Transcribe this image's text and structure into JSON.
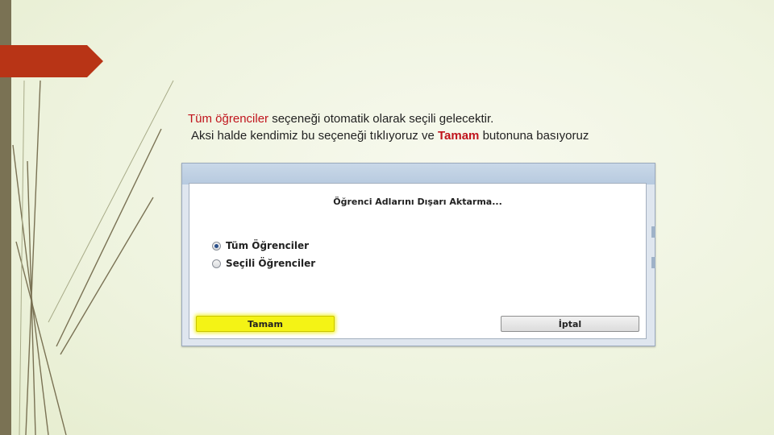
{
  "caption": {
    "line1_highlight": "Tüm öğrenciler",
    "line1_rest": " seçeneği otomatik olarak seçili gelecektir.",
    "line2_start": "Aksi halde kendimiz bu seçeneği tıklıyoruz ve ",
    "line2_highlight": "Tamam",
    "line2_end": " butonuna basıyoruz"
  },
  "dialog": {
    "title": "Öğrenci Adlarını Dışarı Aktarma...",
    "options": [
      {
        "label": "Tüm Öğrenciler",
        "checked": true
      },
      {
        "label": "Seçili Öğrenciler",
        "checked": false
      }
    ],
    "ok_label": "Tamam",
    "cancel_label": "İptal"
  },
  "colors": {
    "accent_red": "#c0141c",
    "highlight_yellow": "#f4f315",
    "tab_red": "#b83416"
  }
}
